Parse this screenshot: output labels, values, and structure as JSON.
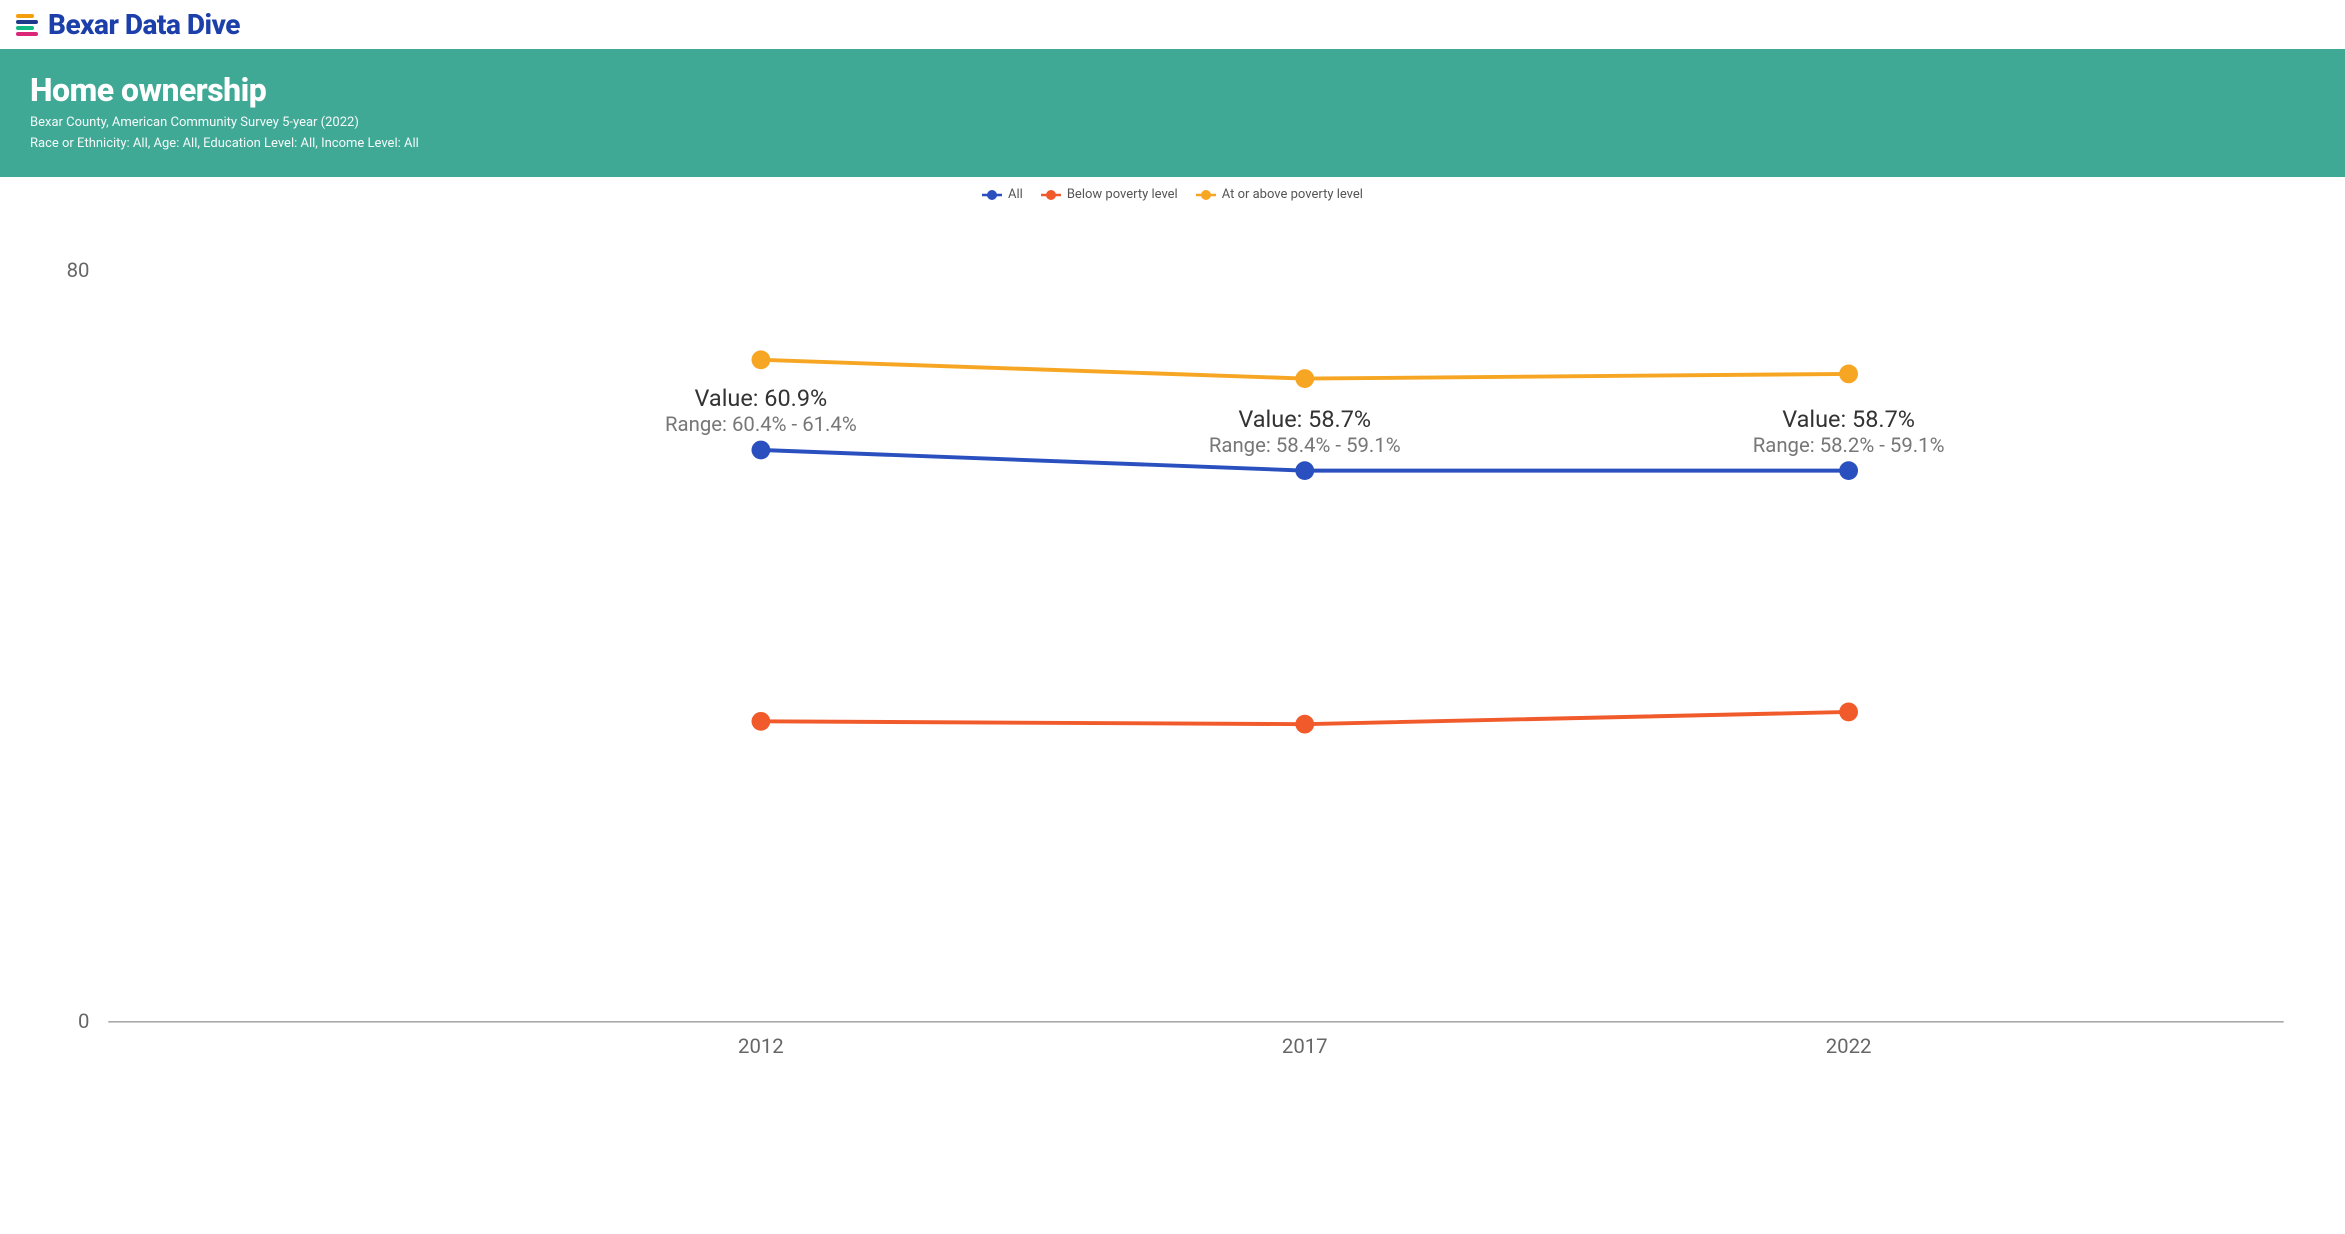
{
  "brand": {
    "name": "Bexar Data Dive",
    "logo_colors": [
      "#f59e0b",
      "#1e3a8a",
      "#10b981",
      "#db2777"
    ]
  },
  "banner": {
    "title": "Home ownership",
    "subtitle1": "Bexar County, American Community Survey 5-year (2022)",
    "subtitle2": "Race or Ethnicity: All, Age: All, Education Level: All, Income Level: All"
  },
  "legend": {
    "items": [
      {
        "label": "All",
        "color": "#2a4fbf"
      },
      {
        "label": "Below poverty level",
        "color": "#f15a2b"
      },
      {
        "label": "At or above poverty level",
        "color": "#f6a623"
      }
    ]
  },
  "chart_data": {
    "type": "line",
    "categories": [
      "2012",
      "2017",
      "2022"
    ],
    "ylim": [
      0,
      80
    ],
    "yticks": [
      "0",
      "80"
    ],
    "series": [
      {
        "name": "All",
        "color": "#2a4fbf",
        "values": [
          60.9,
          58.7,
          58.7
        ]
      },
      {
        "name": "Below poverty level",
        "color": "#f15a2b",
        "values": [
          32,
          31.7,
          33
        ]
      },
      {
        "name": "At or above poverty level",
        "color": "#f6a623",
        "values": [
          70.5,
          68.5,
          69
        ]
      }
    ],
    "annotations": {
      "series": "All",
      "points": [
        {
          "x": "2012",
          "value_label": "Value: 60.9%",
          "range_label": "Range: 60.4% - 61.4%"
        },
        {
          "x": "2017",
          "value_label": "Value: 58.7%",
          "range_label": "Range: 58.4% - 59.1%"
        },
        {
          "x": "2022",
          "value_label": "Value: 58.7%",
          "range_label": "Range: 58.2% - 59.1%"
        }
      ]
    }
  }
}
